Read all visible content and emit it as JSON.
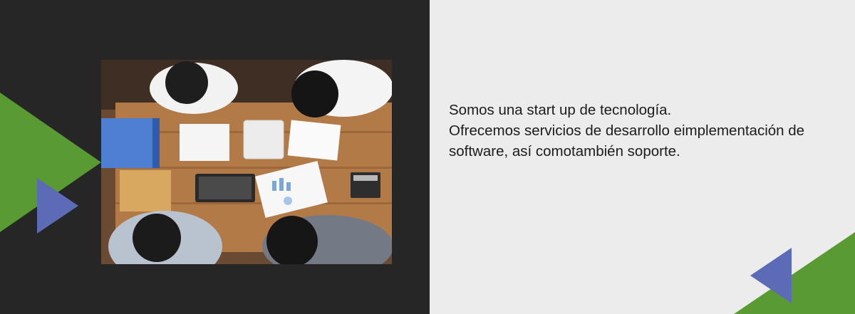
{
  "colors": {
    "dark_panel": "#262626",
    "light_panel": "#ececec",
    "accent_green": "#5a9a32",
    "accent_blue": "#5b6bb6"
  },
  "text": {
    "line1": "Somos una start up de tecnología.",
    "line2": "Ofrecemos servicios de desarrollo eimplementación de software, así comotambién soporte."
  },
  "image": {
    "alt": "team-meeting-photo"
  }
}
